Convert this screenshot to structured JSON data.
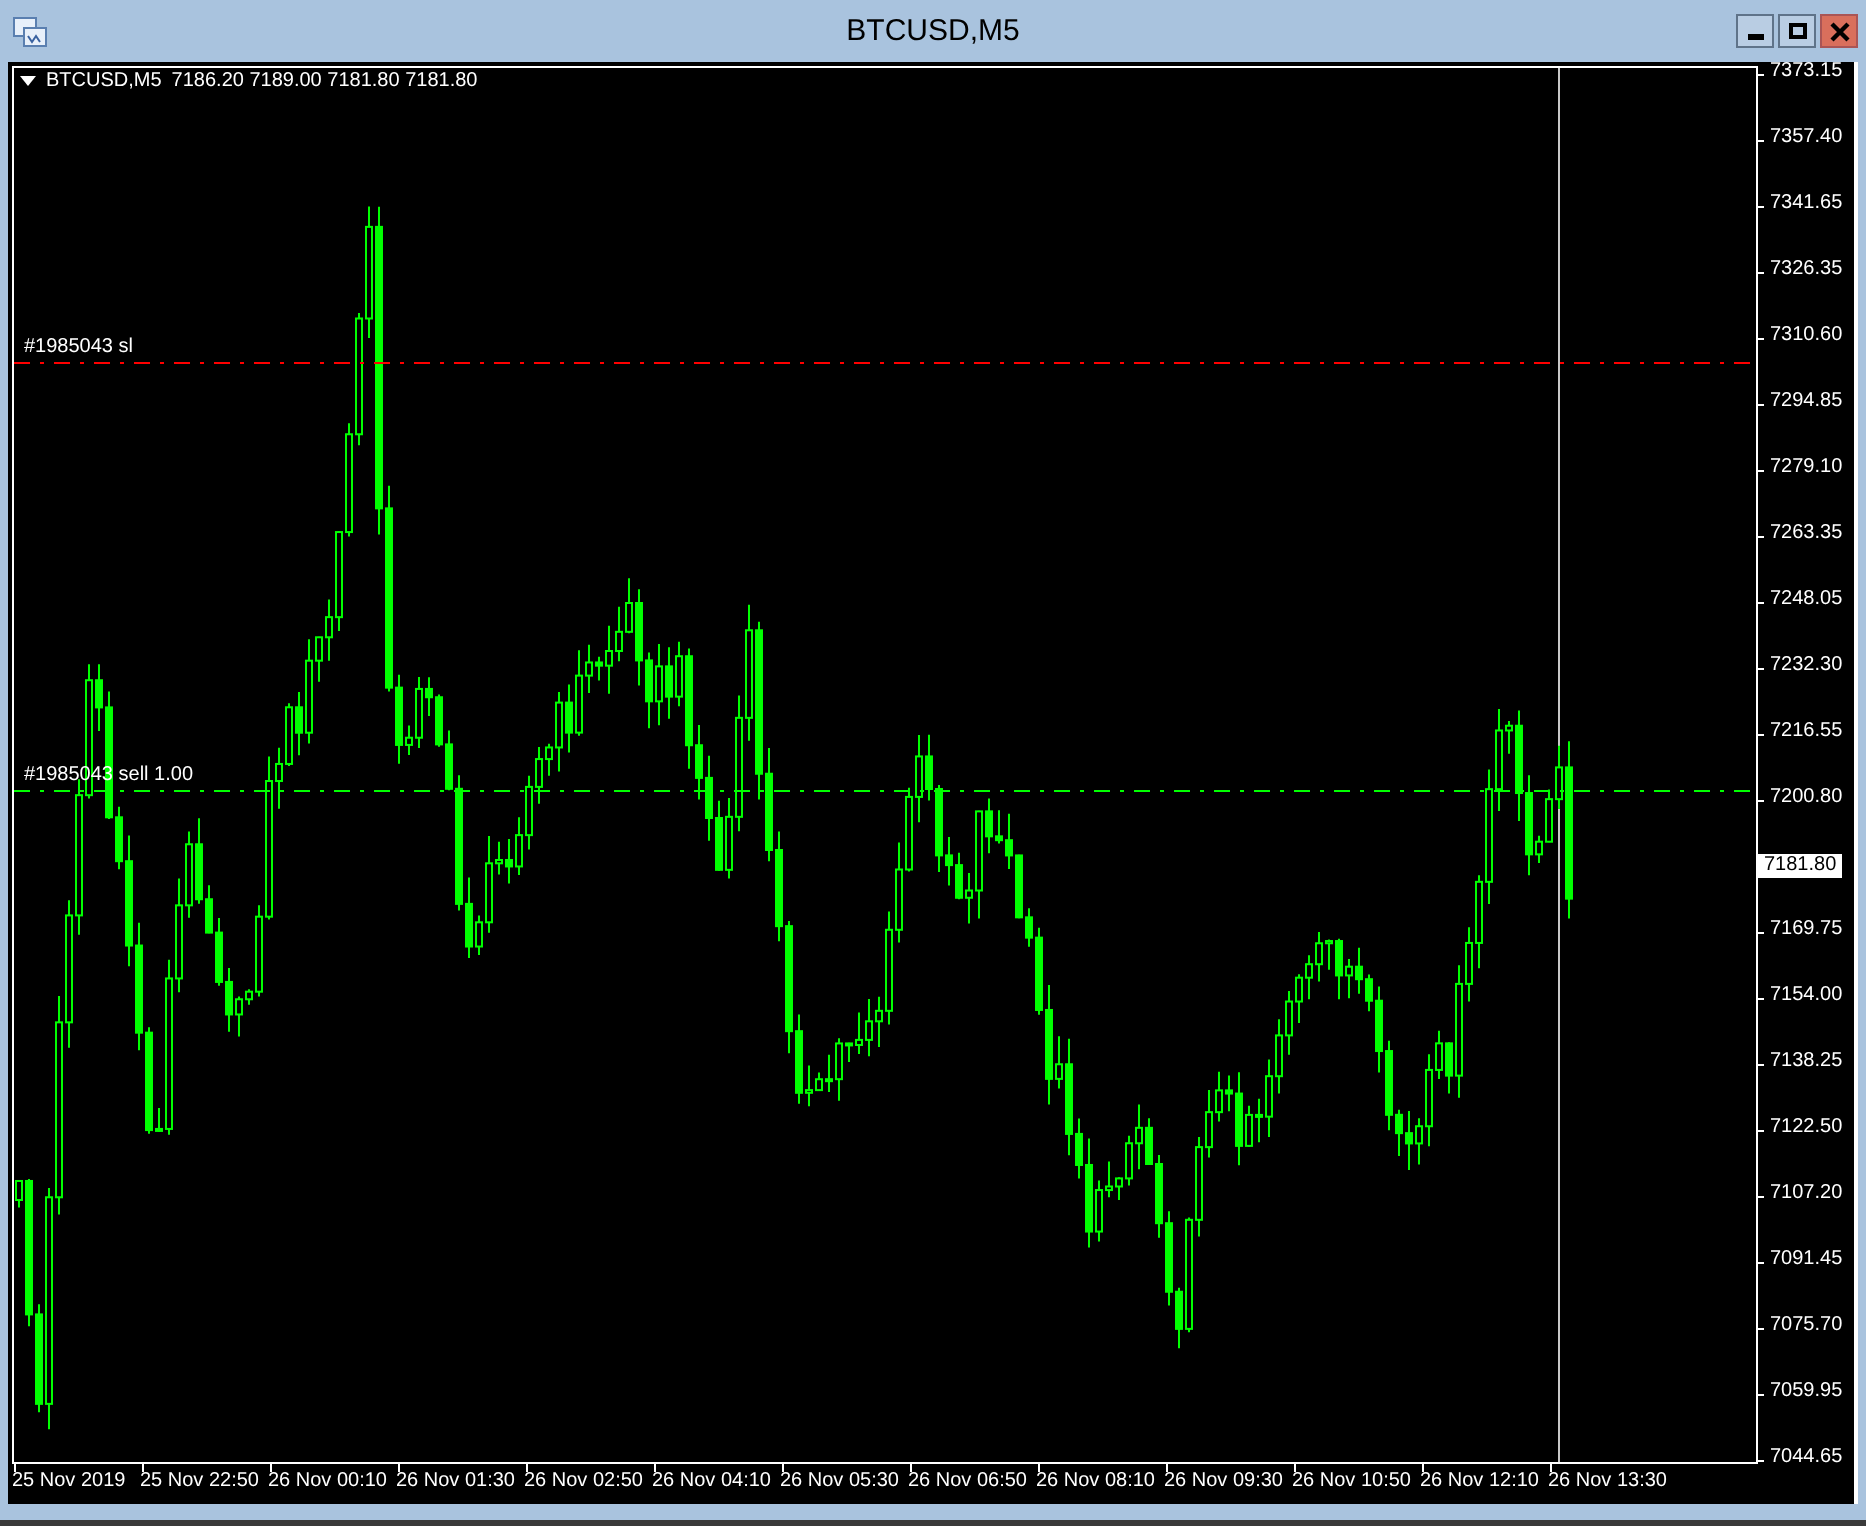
{
  "window": {
    "title": "BTCUSD,M5"
  },
  "chart": {
    "symbol_label": "BTCUSD,M5",
    "ohlc": "7186.20 7189.00 7181.80 7181.80",
    "order_lines": [
      {
        "label": "#1985043 sl",
        "kind": "stop_loss",
        "color": "#ff0000"
      },
      {
        "label": "#1985043 sell 1.00",
        "kind": "entry",
        "color": "#00ff00"
      }
    ],
    "price_labels": [
      "7373.15",
      "7357.40",
      "7341.65",
      "7326.35",
      "7310.60",
      "7294.85",
      "7279.10",
      "7263.35",
      "7248.05",
      "7232.30",
      "7216.55",
      "7200.80",
      "7169.75",
      "7154.00",
      "7138.25",
      "7122.50",
      "7107.20",
      "7091.45",
      "7075.70",
      "7059.95",
      "7044.65"
    ],
    "current_price": "7181.80",
    "time_labels": [
      "25 Nov 2019",
      "25 Nov 22:50",
      "26 Nov 00:10",
      "26 Nov 01:30",
      "26 Nov 02:50",
      "26 Nov 04:10",
      "26 Nov 05:30",
      "26 Nov 06:50",
      "26 Nov 08:10",
      "26 Nov 09:30",
      "26 Nov 10:50",
      "26 Nov 12:10",
      "26 Nov 13:30"
    ]
  }
}
